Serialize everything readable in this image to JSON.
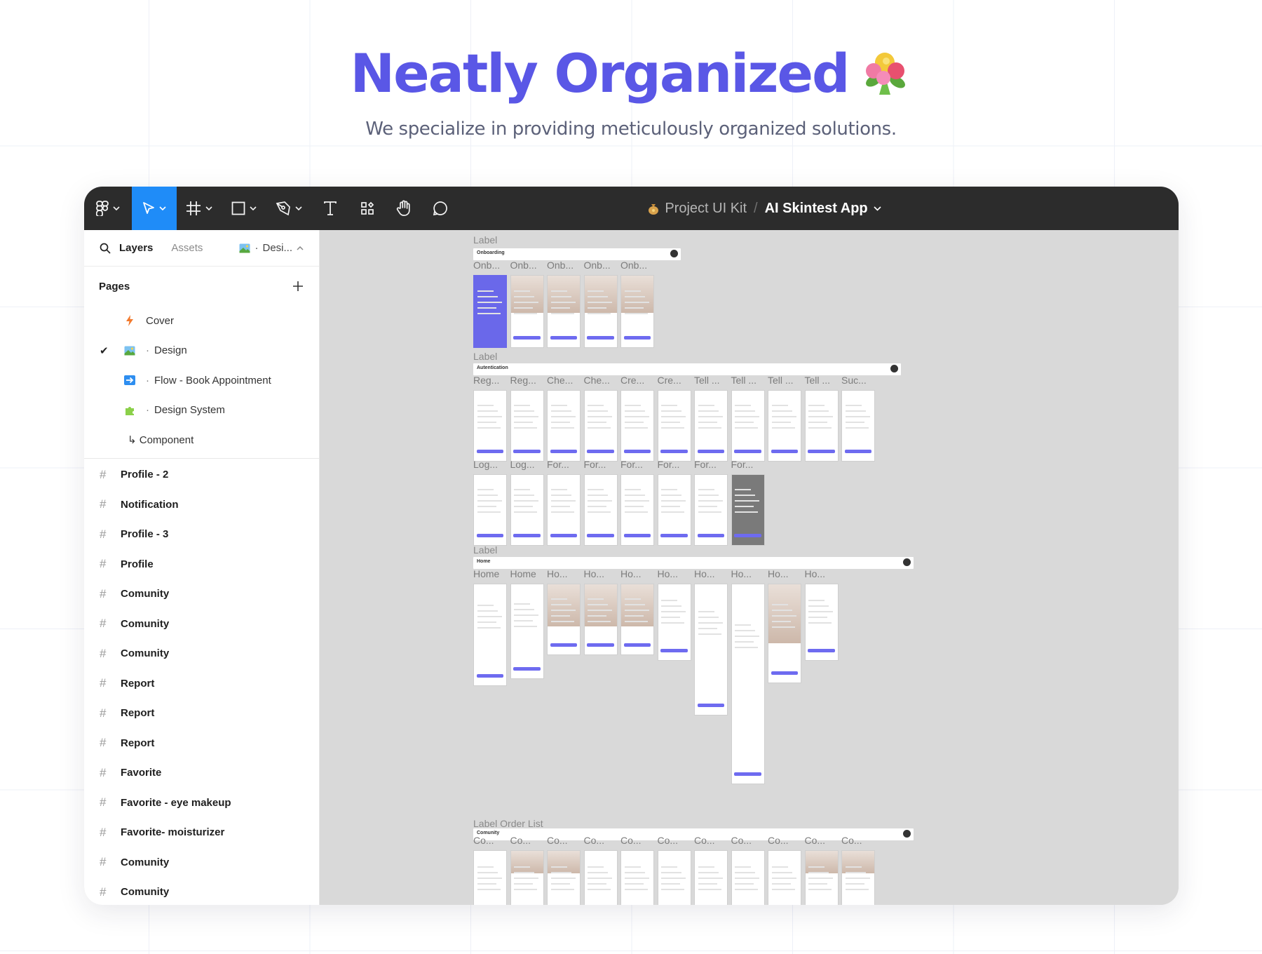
{
  "hero": {
    "title": "Neatly Organized",
    "subtitle": "We specialize in providing meticulously organized solutions."
  },
  "toolbar": {
    "project": "Project UI Kit",
    "separator": "/",
    "file": "AI Skintest App",
    "icons": [
      "figma-menu-icon",
      "move-tool-icon",
      "frame-tool-icon",
      "shape-tool-icon",
      "pen-tool-icon",
      "text-tool-icon",
      "resources-icon",
      "hand-tool-icon",
      "comment-icon"
    ]
  },
  "sidebar": {
    "tab_layers": "Layers",
    "tab_assets": "Assets",
    "page_selector": "Desi...",
    "pages_title": "Pages",
    "pages": [
      {
        "label": "Cover",
        "dot": ""
      },
      {
        "label": "Design",
        "dot": "·"
      },
      {
        "label": "Flow - Book Appointment",
        "dot": "·"
      },
      {
        "label": "Design System",
        "dot": "·"
      },
      {
        "label": "↳ Component",
        "dot": ""
      }
    ],
    "layers": [
      "Profile - 2",
      "Notification",
      "Profile - 3",
      "Profile",
      "Comunity",
      "Comunity",
      "Comunity",
      "Report",
      "Report",
      "Report",
      "Favorite",
      "Favorite - eye makeup",
      "Favorite- moisturizer",
      "Comunity",
      "Comunity"
    ]
  },
  "canvas": {
    "section1": {
      "label": "Label",
      "bar": "Onboarding",
      "frames": [
        "Onb...",
        "Onb...",
        "Onb...",
        "Onb...",
        "Onb..."
      ]
    },
    "section2": {
      "label": "Label",
      "bar": "Autentication",
      "row1": [
        "Reg...",
        "Reg...",
        "Che...",
        "Che...",
        "Cre...",
        "Cre...",
        "Tell ...",
        "Tell ...",
        "Tell ...",
        "Tell ...",
        "Suc..."
      ],
      "row2": [
        "Log...",
        "Log...",
        "For...",
        "For...",
        "For...",
        "For...",
        "For...",
        "For..."
      ]
    },
    "section3": {
      "label": "Label",
      "bar": "Home",
      "frames": [
        "Home",
        "Home",
        "Ho...",
        "Ho...",
        "Ho...",
        "Ho...",
        "Ho...",
        "Ho...",
        "Ho...",
        "Ho..."
      ]
    },
    "section4": {
      "label": "Label Order List",
      "bar": "Comunity",
      "frames": [
        "Co...",
        "Co...",
        "Co...",
        "Co...",
        "Co...",
        "Co...",
        "Co...",
        "Co...",
        "Co...",
        "Co...",
        "Co..."
      ]
    }
  },
  "colors": {
    "accent": "#5a57e6",
    "toolbar_bg": "#2c2c2c",
    "active_tool": "#1f8cf8",
    "canvas_bg": "#d9d9d9"
  }
}
